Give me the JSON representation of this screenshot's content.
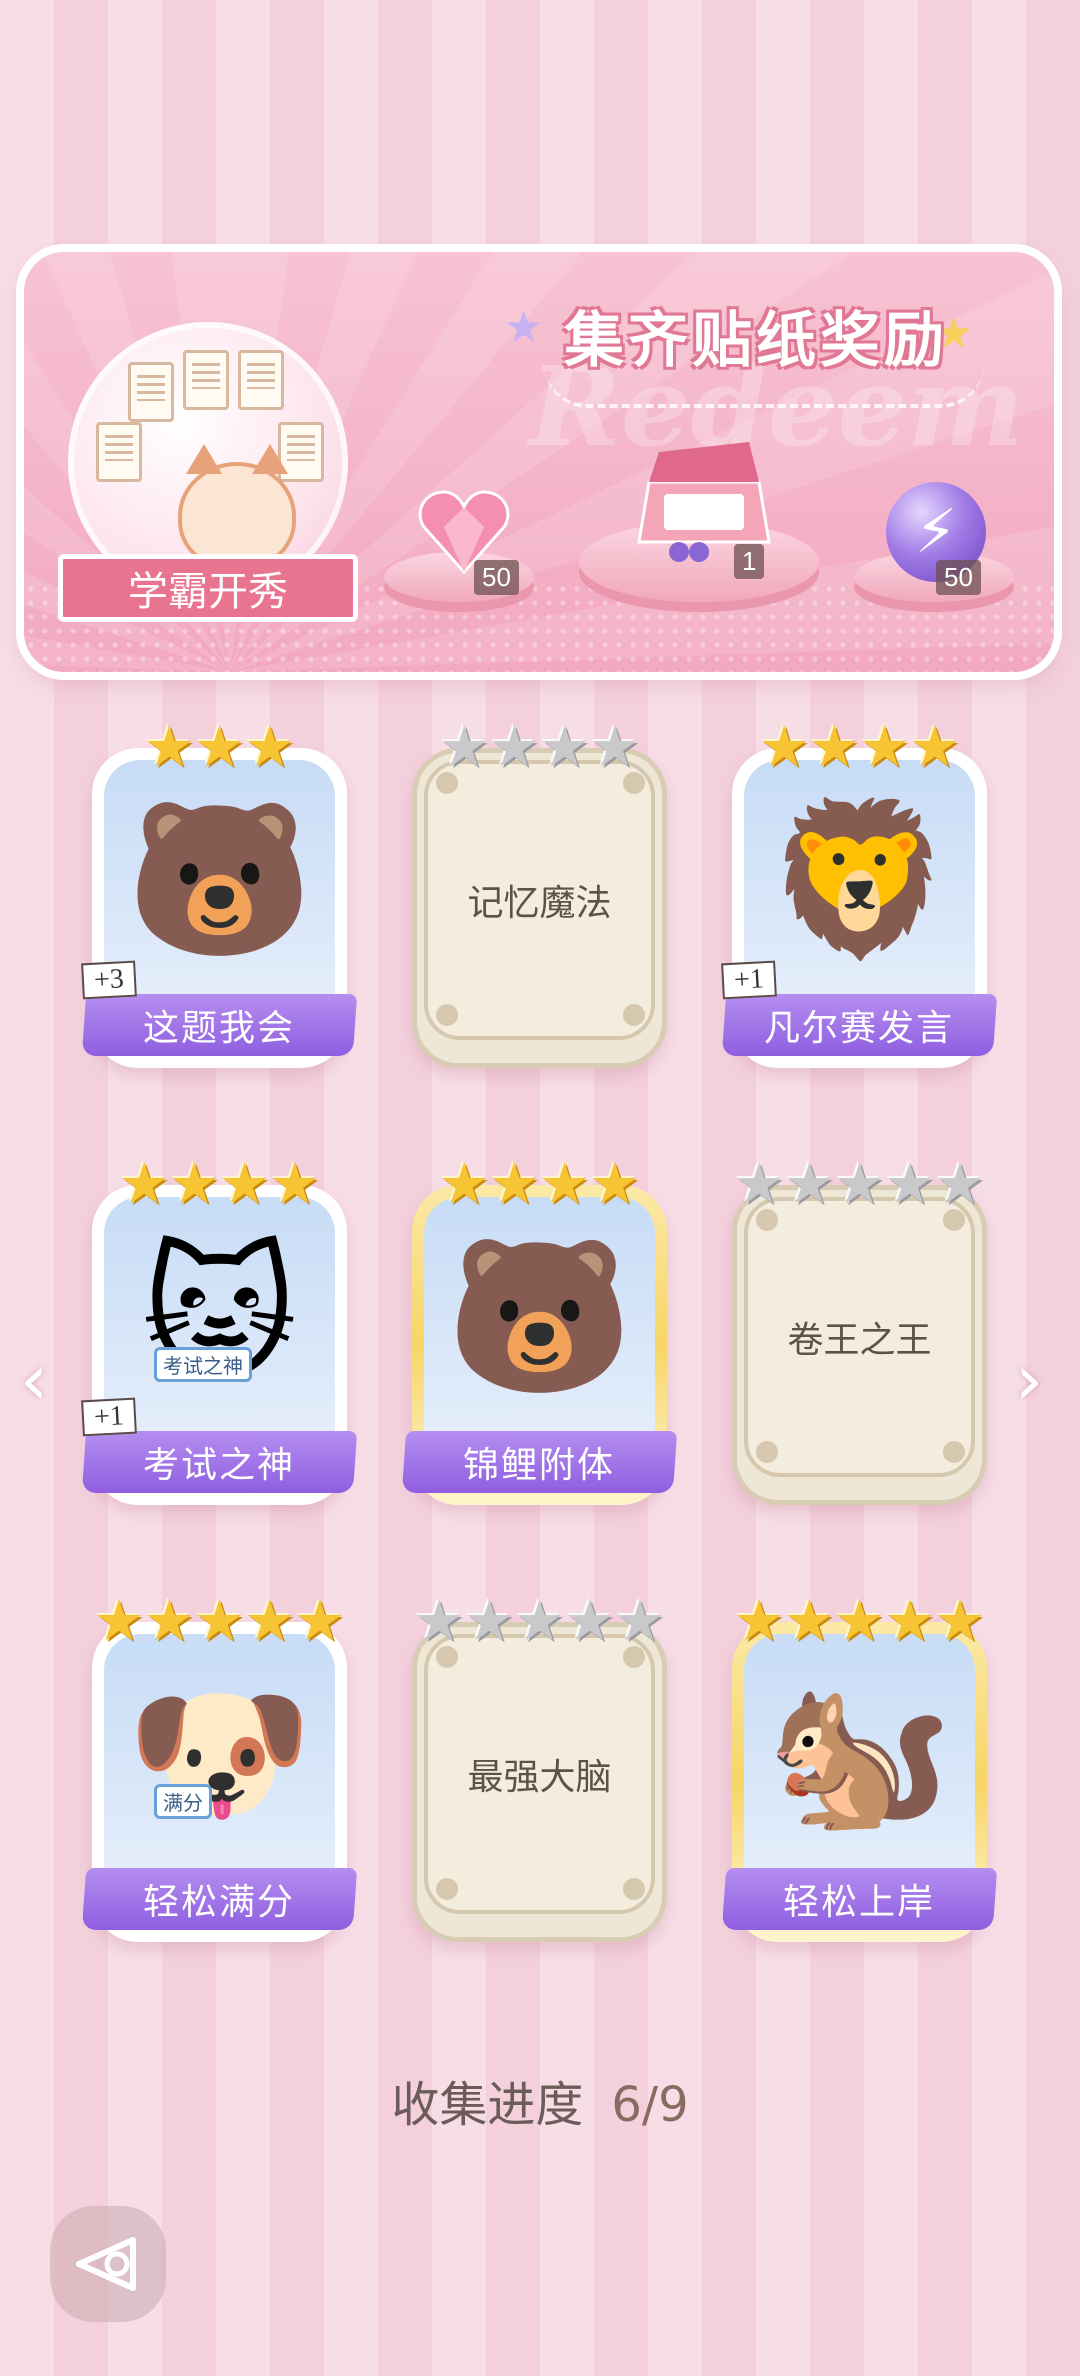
{
  "banner": {
    "title": "集齐贴纸奖励",
    "watermark": "Redeem",
    "ribbon_label": "学霸开秀",
    "rewards": [
      {
        "icon": "pink-heart-gem-icon",
        "count": "50"
      },
      {
        "icon": "gift-box-icon",
        "count": "1"
      },
      {
        "icon": "lightning-orb-icon",
        "count": "50"
      }
    ]
  },
  "stickers": [
    {
      "name": "这题我会",
      "collected": true,
      "stars": 3,
      "bonus": "+3",
      "icon": "bear-at-desk-icon",
      "gold": false
    },
    {
      "name": "记忆魔法",
      "collected": false,
      "stars": 4,
      "bonus": "",
      "icon": "locked-card",
      "gold": false
    },
    {
      "name": "凡尔赛发言",
      "collected": true,
      "stars": 4,
      "bonus": "+1",
      "icon": "lion-microphone-icon",
      "gold": false
    },
    {
      "name": "考试之神",
      "collected": true,
      "stars": 4,
      "bonus": "+1",
      "icon": "angel-cat-icon",
      "gold": false,
      "sign": "考试之神"
    },
    {
      "name": "锦鲤附体",
      "collected": true,
      "stars": 4,
      "bonus": "",
      "icon": "bear-koi-icon",
      "gold": true
    },
    {
      "name": "卷王之王",
      "collected": false,
      "stars": 5,
      "bonus": "",
      "icon": "locked-card",
      "gold": false
    },
    {
      "name": "轻松满分",
      "collected": true,
      "stars": 5,
      "bonus": "",
      "icon": "puppy-full-score-icon",
      "gold": false,
      "sign": "满分"
    },
    {
      "name": "最强大脑",
      "collected": false,
      "stars": 5,
      "bonus": "",
      "icon": "locked-card",
      "gold": false
    },
    {
      "name": "轻松上岸",
      "collected": true,
      "stars": 5,
      "bonus": "",
      "icon": "squirrel-graduate-icon",
      "gold": true
    }
  ],
  "progress": {
    "label": "收集进度",
    "value": "6/9"
  },
  "nav": {
    "prev_icon": "chevron-left-icon",
    "next_icon": "chevron-right-icon",
    "back_icon": "back-triangle-icon"
  }
}
